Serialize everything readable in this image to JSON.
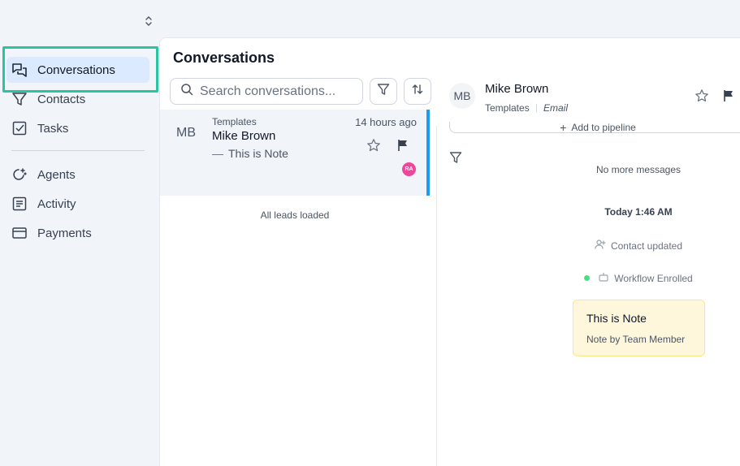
{
  "sidebar": {
    "nav": [
      {
        "label": "Conversations",
        "icon": "chat-bubbles-icon",
        "active": true
      },
      {
        "label": "Contacts",
        "icon": "funnel-icon",
        "active": false
      },
      {
        "label": "Tasks",
        "icon": "checkbox-icon",
        "active": false
      },
      {
        "label": "Agents",
        "icon": "agents-icon",
        "active": false
      },
      {
        "label": "Activity",
        "icon": "list-icon",
        "active": false
      },
      {
        "label": "Payments",
        "icon": "credit-card-icon",
        "active": false
      }
    ]
  },
  "conversations": {
    "title": "Conversations",
    "search_placeholder": "Search conversations...",
    "items": [
      {
        "initials": "MB",
        "source": "Templates",
        "name": "Mike Brown",
        "preview": "This is Note",
        "time": "14 hours ago",
        "assignee": "RA"
      }
    ],
    "footer": "All leads loaded"
  },
  "detail": {
    "initials": "MB",
    "name": "Mike Brown",
    "source": "Templates",
    "channel": "Email",
    "pipeline_label": "Add to pipeline",
    "no_more_messages": "No more messages",
    "day_marker": "Today 1:46 AM",
    "events": [
      "Contact updated",
      "Workflow Enrolled"
    ],
    "note": {
      "title": "This is Note",
      "author": "Note by Team Member"
    }
  },
  "colors": {
    "accent": "#1d9bf0",
    "active_nav": "#dbeafe",
    "highlight": "#2bc4a0",
    "note_bg": "#fef7dc",
    "assignee_badge": "#ec4899"
  }
}
